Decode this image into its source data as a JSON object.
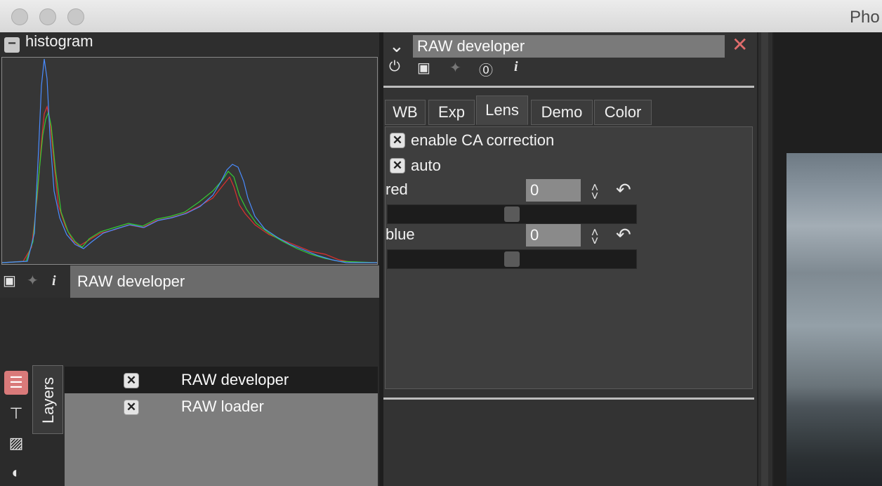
{
  "window": {
    "title": "Pho"
  },
  "histogram": {
    "title": "histogram",
    "collapse_icon": "minus-icon"
  },
  "left_panel": {
    "toolbar_icons": [
      "camera-icon",
      "pin-icon",
      "info-icon"
    ],
    "selected_layer": "RAW developer"
  },
  "sidebar": {
    "icons": [
      "layers-icon",
      "tree-icon",
      "image-icon",
      "contrast-icon"
    ],
    "active_tab": "Layers"
  },
  "layers": [
    {
      "label": "RAW developer",
      "enabled": true,
      "selected": true
    },
    {
      "label": "RAW loader",
      "enabled": true,
      "selected": false
    }
  ],
  "module": {
    "title": "RAW developer",
    "collapse_icon": "chevron-down-icon",
    "close_icon": "close-icon",
    "toolbar_icons": [
      "power-icon",
      "camera-icon",
      "pin-icon",
      "opacity-icon",
      "info-icon"
    ],
    "tabs": [
      "WB",
      "Exp",
      "Lens",
      "Demo",
      "Color"
    ],
    "active_tab": "Lens",
    "options": {
      "ca_correction": {
        "label": "enable CA correction",
        "checked": true
      },
      "auto": {
        "label": "auto",
        "checked": true
      }
    },
    "sliders": {
      "red": {
        "label": "red",
        "value": "0",
        "position": 0.5
      },
      "blue": {
        "label": "blue",
        "value": "0",
        "position": 0.5
      }
    }
  },
  "colors": {
    "accent_close": "#e06c6c",
    "hist_red": "#e03030",
    "hist_green": "#33cc33",
    "hist_blue": "#4a8cff"
  }
}
